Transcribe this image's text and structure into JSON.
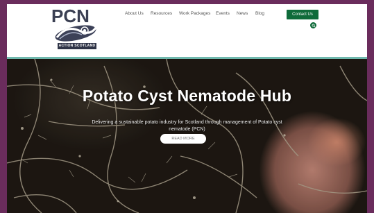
{
  "logo": {
    "title": "PCN",
    "tagline": "ACTION SCOTLAND"
  },
  "nav": {
    "items": [
      "About Us",
      "Resources",
      "Work Packages",
      "Events",
      "News",
      "Blog"
    ],
    "contact_label": "Contact Us"
  },
  "hero": {
    "title": "Potato Cyst Nematode Hub",
    "subtitle": "Delivering a sustainable potato industry for Scotland through management of Potato cyst nematode (PCN)",
    "cta_label": "READ MORE"
  },
  "colors": {
    "brand_green": "#0f6b3a",
    "frame_purple": "#6a2c5c",
    "accent_teal": "#6fb8ad",
    "logo_navy": "#2f3447"
  },
  "icons": {
    "search": "search-icon"
  }
}
